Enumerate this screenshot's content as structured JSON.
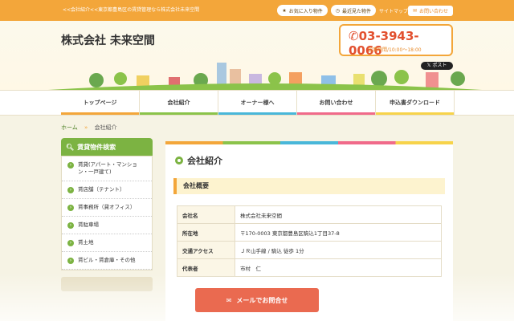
{
  "topbar": {
    "lead": "<<会社紹介<<東京都豊島区の賃貸管理なら株式会社未来空間",
    "favorites": "お気に入り物件",
    "recent": "最近見た物件",
    "sitemap": "サイトマップ",
    "contact": "お問い合わせ"
  },
  "header": {
    "title": "株式会社 未来空間",
    "phone": "03-3943-0066",
    "hours": "営業時間/10:00〜18:00",
    "post": "ポスト"
  },
  "nav": {
    "items": [
      {
        "label": "トップページ",
        "color": "#f3a63a"
      },
      {
        "label": "会社紹介",
        "color": "#8bc34a"
      },
      {
        "label": "オーナー様へ",
        "color": "#49b7d9"
      },
      {
        "label": "お問い合わせ",
        "color": "#f06a8a"
      },
      {
        "label": "申込書ダウンロード",
        "color": "#f7d34a"
      }
    ]
  },
  "breadcrumb": {
    "home": "ホーム",
    "sep": "»",
    "current": "会社紹介"
  },
  "sidebar": {
    "heading": "賃貸物件検索",
    "items": [
      "賃貸(アパート・マンション・一戸建て)",
      "賃店舗（テナント）",
      "賃事務所（貸オフィス）",
      "賃駐車場",
      "賃土地",
      "賃ビル・賃倉庫・その他"
    ]
  },
  "main": {
    "title": "会社紹介",
    "section": "会社概要",
    "rows": [
      {
        "k": "会社名",
        "v": "株式会社未来空間"
      },
      {
        "k": "所在地",
        "v": "〒170-0003 東京都豊島区駒込1丁目37-8"
      },
      {
        "k": "交通アクセス",
        "v": "ＪＲ山手線 / 駒込 徒歩 1分"
      },
      {
        "k": "代表者",
        "v": "市村　仁"
      }
    ]
  },
  "cta": {
    "label": "メールでお問合せ"
  },
  "colors": {
    "accent": "#f3a63a",
    "green": "#7cb342",
    "cta": "#ea6a50"
  }
}
